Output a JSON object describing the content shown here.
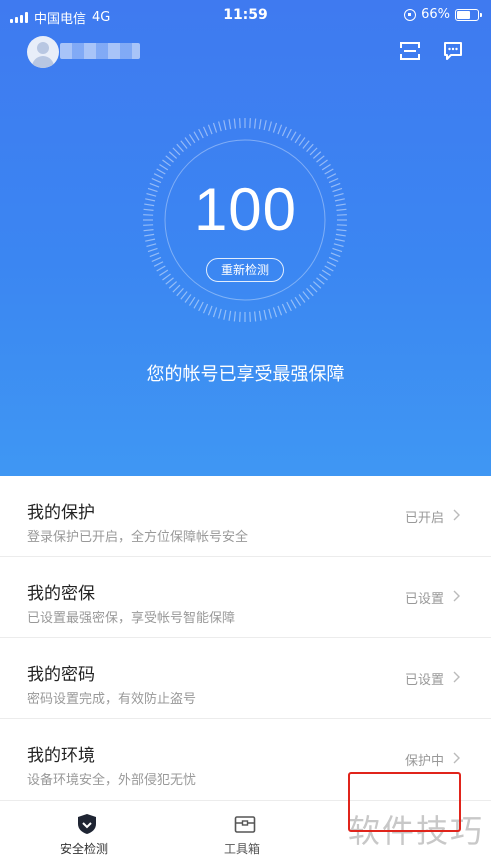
{
  "status_bar": {
    "carrier": "中国电信",
    "network": "4G",
    "time": "11:59",
    "battery": "66%",
    "battery_level": 0.66
  },
  "header": {
    "avatar_icon": "user-avatar-icon",
    "scan_icon": "scan-icon",
    "message_icon": "message-icon"
  },
  "score": {
    "value": "100",
    "recheck_label": "重新检测",
    "status_text": "您的帐号已享受最强保障"
  },
  "items": [
    {
      "title": "我的保护",
      "desc": "登录保护已开启，全方位保障帐号安全",
      "status": "已开启"
    },
    {
      "title": "我的密保",
      "desc": "已设置最强密保，享受帐号智能保障",
      "status": "已设置"
    },
    {
      "title": "我的密码",
      "desc": "密码设置完成，有效防止盗号",
      "status": "已设置"
    },
    {
      "title": "我的环境",
      "desc": "设备环境安全，外部侵犯无忧",
      "status": "保护中"
    }
  ],
  "tabs": [
    {
      "label": "安全检测",
      "icon": "shield-icon"
    },
    {
      "label": "工具箱",
      "icon": "toolbox-icon"
    }
  ],
  "watermark": "软件技巧",
  "colors": {
    "hero_top": "#3f7af0",
    "hero_bottom": "#3f97f3",
    "highlight": "#e0241b"
  }
}
